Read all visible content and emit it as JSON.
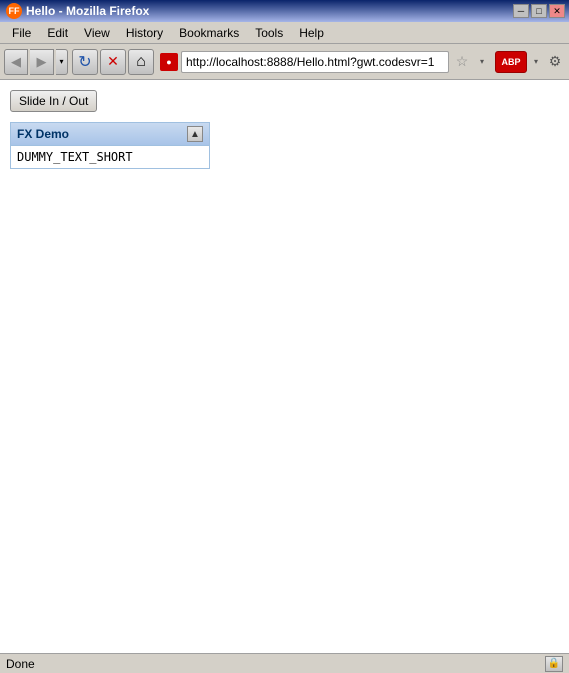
{
  "titlebar": {
    "title": "Hello - Mozilla Firefox",
    "icon": "FF",
    "controls": {
      "minimize": "─",
      "maximize": "□",
      "close": "✕"
    }
  },
  "menubar": {
    "items": [
      {
        "label": "File"
      },
      {
        "label": "Edit"
      },
      {
        "label": "View"
      },
      {
        "label": "History"
      },
      {
        "label": "Bookmarks"
      },
      {
        "label": "Tools"
      },
      {
        "label": "Help"
      }
    ]
  },
  "toolbar": {
    "back_arrow": "◀",
    "forward_arrow": "▶",
    "dropdown_arrow": "▾",
    "reload": "↻",
    "stop": "✕",
    "home": "⌂",
    "url": "http://localhost:8888/Hello.html?gwt.codesvr=1",
    "star": "☆",
    "abp": "ABP",
    "gear": "⚙"
  },
  "content": {
    "slide_button": "Slide In / Out",
    "fx_panel": {
      "title": "FX Demo",
      "scroll_arrow": "▲",
      "body_text": "DUMMY_TEXT_SHORT"
    }
  },
  "statusbar": {
    "text": "Done",
    "icon": "🔒"
  }
}
